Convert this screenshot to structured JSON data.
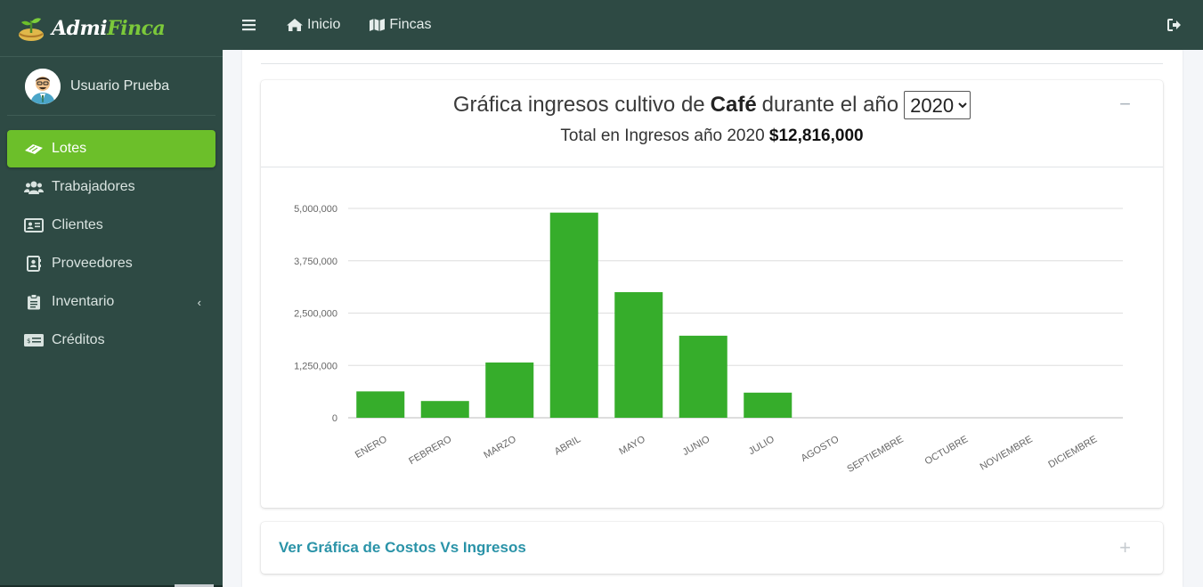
{
  "brand": {
    "name_a": "Admi",
    "name_b": "Finca"
  },
  "user": {
    "name": "Usuario Prueba"
  },
  "sidebar": {
    "items": [
      {
        "label": "Lotes",
        "icon": "lotes-icon",
        "active": true
      },
      {
        "label": "Trabajadores",
        "icon": "users-icon"
      },
      {
        "label": "Clientes",
        "icon": "id-card-icon"
      },
      {
        "label": "Proveedores",
        "icon": "address-book-icon"
      },
      {
        "label": "Inventario",
        "icon": "clipboard-icon",
        "caret": "‹"
      },
      {
        "label": "Créditos",
        "icon": "money-icon"
      }
    ]
  },
  "topbar": {
    "home_label": "Inicio",
    "fincas_label": "Fincas"
  },
  "chart_card": {
    "title_prefix": "Gráfica ingresos cultivo de",
    "crop": "Café",
    "title_suffix": "durante el año",
    "selected_year": "2020",
    "total_prefix": "Total en Ingresos año 2020",
    "total_value": "$12,816,000",
    "collapse_symbol": "−"
  },
  "footer_card": {
    "link_label": "Ver Gráfica de Costos Vs Ingresos",
    "expand_symbol": "+"
  },
  "colors": {
    "sidebar_bg": "#2e4a44",
    "active_green": "#6cbf2a",
    "bar_green": "#36ad2b",
    "link_teal": "#2a93a8"
  },
  "chart_data": {
    "type": "bar",
    "categories": [
      "ENERO",
      "FEBRERO",
      "MARZO",
      "ABRIL",
      "MAYO",
      "JUNIO",
      "JULIO",
      "AGOSTO",
      "SEPTIEMBRE",
      "OCTUBRE",
      "NOVIEMBRE",
      "DICIEMBRE"
    ],
    "values": [
      630000,
      400000,
      1320000,
      4900000,
      3000000,
      1960000,
      600000,
      0,
      0,
      0,
      0,
      0
    ],
    "ylim": [
      0,
      5000000
    ],
    "yticks": [
      0,
      1250000,
      2500000,
      3750000,
      5000000
    ],
    "ytick_labels": [
      "0",
      "1,250,000",
      "2,500,000",
      "3,750,000",
      "5,000,000"
    ],
    "grid": true,
    "title": "",
    "xlabel": "",
    "ylabel": ""
  }
}
